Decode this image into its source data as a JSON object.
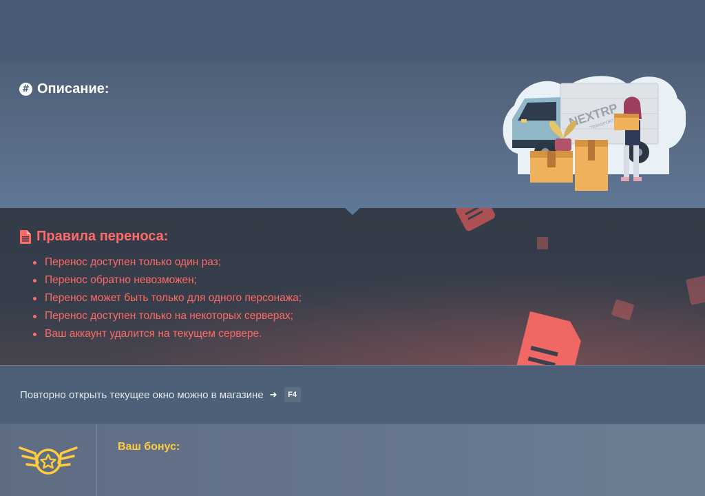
{
  "description": {
    "title": "Описание:",
    "icon": "hash-icon",
    "illustration": {
      "truck_brand": "NEXTRP",
      "truck_sub": "TRANSPORTER"
    }
  },
  "rules": {
    "title": "Правила переноса:",
    "icon": "document-icon",
    "items": [
      "Перенос доступен только один раз;",
      "Перенос обратно невозможен;",
      "Перенос может быть только для одного персонажа;",
      "Перенос доступен только на некоторых серверах;",
      "Ваш аккаунт удалится на текущем сервере."
    ],
    "accent_color": "#ff6b66"
  },
  "hint": {
    "text": "Повторно открыть текущее окно можно в магазине",
    "arrow": "➜",
    "key": "F4"
  },
  "bonus": {
    "label": "Ваш бонус:",
    "icon": "winged-star-badge-icon",
    "accent_color": "#ffcc3d"
  }
}
